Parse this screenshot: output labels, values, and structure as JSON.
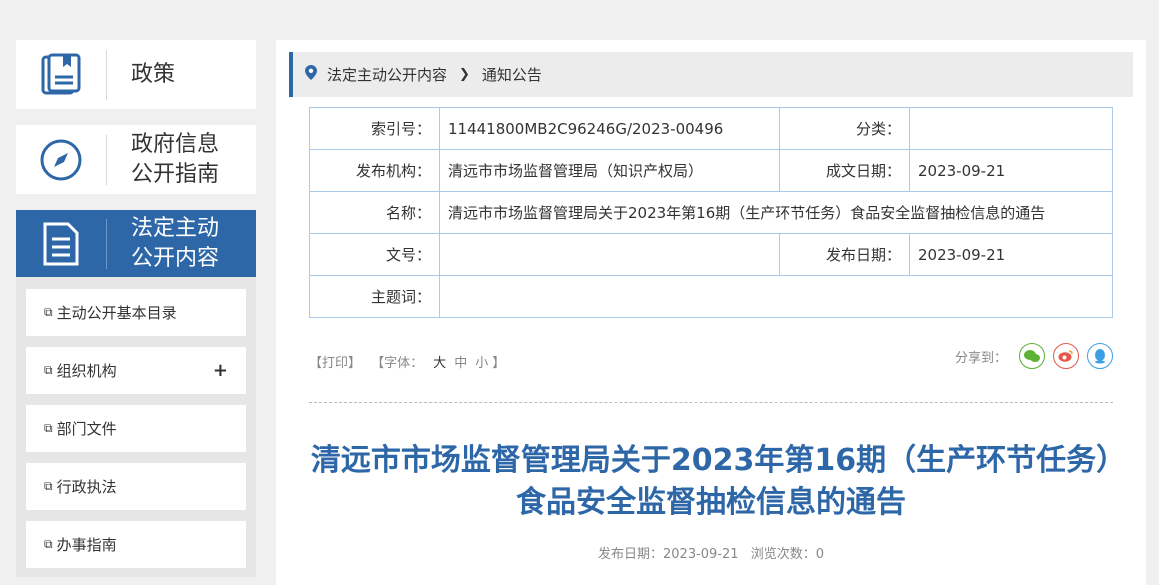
{
  "sidebar": {
    "nav": [
      {
        "label": "政策",
        "icon": "book-icon"
      },
      {
        "label1": "政府信息",
        "label2": "公开指南",
        "icon": "compass-icon"
      },
      {
        "label1": "法定主动",
        "label2": "公开内容",
        "icon": "document-icon"
      }
    ],
    "items": [
      {
        "label": "主动公开基本目录"
      },
      {
        "label": "组织机构",
        "expand": "+"
      },
      {
        "label": "部门文件"
      },
      {
        "label": "行政执法"
      },
      {
        "label": "办事指南"
      }
    ]
  },
  "breadcrumb": {
    "level1": "法定主动公开内容",
    "level2": "通知公告"
  },
  "meta": {
    "index_label": "索引号：",
    "index_value": "11441800MB2C96246G/2023-00496",
    "category_label": "分类：",
    "category_value": "",
    "org_label": "发布机构：",
    "org_value": "清远市市场监督管理局（知识产权局）",
    "created_label": "成文日期：",
    "created_value": "2023-09-21",
    "name_label": "名称：",
    "name_value": "清远市市场监督管理局关于2023年第16期（生产环节任务）食品安全监督抽检信息的通告",
    "docno_label": "文号：",
    "docno_value": "",
    "published_label": "发布日期：",
    "published_value": "2023-09-21",
    "keywords_label": "主题词：",
    "keywords_value": ""
  },
  "tools": {
    "print": "【打印】",
    "font_prefix": "【字体：",
    "font_large": "大",
    "font_medium": "中",
    "font_small": "小",
    "font_suffix": "】",
    "share_label": "分享到："
  },
  "article": {
    "title": "清远市市场监督管理局关于2023年第16期（生产环节任务）食品安全监督抽检信息的通告",
    "pub_label": "发布日期：",
    "pub_date": "2023-09-21",
    "views_label": "浏览次数：",
    "views": "0"
  },
  "colors": {
    "accent": "#2d67a8",
    "border": "#a9cbe8",
    "wechat": "#5bb233",
    "weibo": "#e6574b",
    "qq": "#3aa0e3"
  }
}
